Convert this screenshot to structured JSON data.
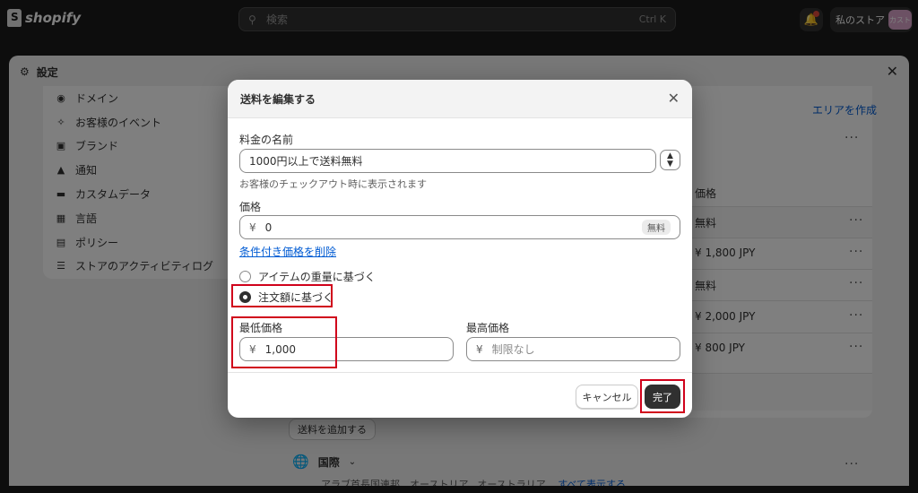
{
  "topbar": {
    "brand": "shopify",
    "search_placeholder": "検索",
    "search_shortcut": "Ctrl K",
    "store_name": "私のストア",
    "avatar_text": "カスト"
  },
  "settings": {
    "title": "設定",
    "nav": [
      {
        "label": "ドメイン",
        "icon": "globe-icon"
      },
      {
        "label": "お客様のイベント",
        "icon": "sparkle-icon"
      },
      {
        "label": "ブランド",
        "icon": "image-icon"
      },
      {
        "label": "通知",
        "icon": "bell-icon"
      },
      {
        "label": "カスタムデータ",
        "icon": "database-icon"
      },
      {
        "label": "言語",
        "icon": "language-icon"
      },
      {
        "label": "ポリシー",
        "icon": "policy-icon"
      },
      {
        "label": "ストアのアクティビティログ",
        "icon": "list-icon"
      }
    ],
    "create_area": "エリアを作成",
    "price_header": "価格",
    "rate_rows": [
      "無料",
      "¥ 1,800 JPY",
      "無料",
      "¥ 2,000 JPY",
      "¥ 800 JPY"
    ],
    "add_rate": "送料を追加する",
    "international": "国際",
    "international_sub": "アラブ首長国連邦、オーストリア、オーストラリア、",
    "show_all": "すべて表示する"
  },
  "modal": {
    "title": "送料を編集する",
    "rate_name_label": "料金の名前",
    "rate_name_value": "1000円以上で送料無料",
    "rate_name_help": "お客様のチェックアウト時に表示されます",
    "price_label": "価格",
    "currency": "¥",
    "price_value": "0",
    "free_badge": "無料",
    "remove_condition_link": "条件付き価格を削除",
    "condition_options": [
      {
        "label": "アイテムの重量に基づく",
        "selected": false
      },
      {
        "label": "注文額に基づく",
        "selected": true
      }
    ],
    "min_label": "最低価格",
    "min_value": "1,000",
    "max_label": "最高価格",
    "max_placeholder": "制限なし",
    "cancel": "キャンセル",
    "done": "完了"
  },
  "colors": {
    "highlight": "#d0021b",
    "link": "#005bd3",
    "primary_button": "#303030"
  }
}
